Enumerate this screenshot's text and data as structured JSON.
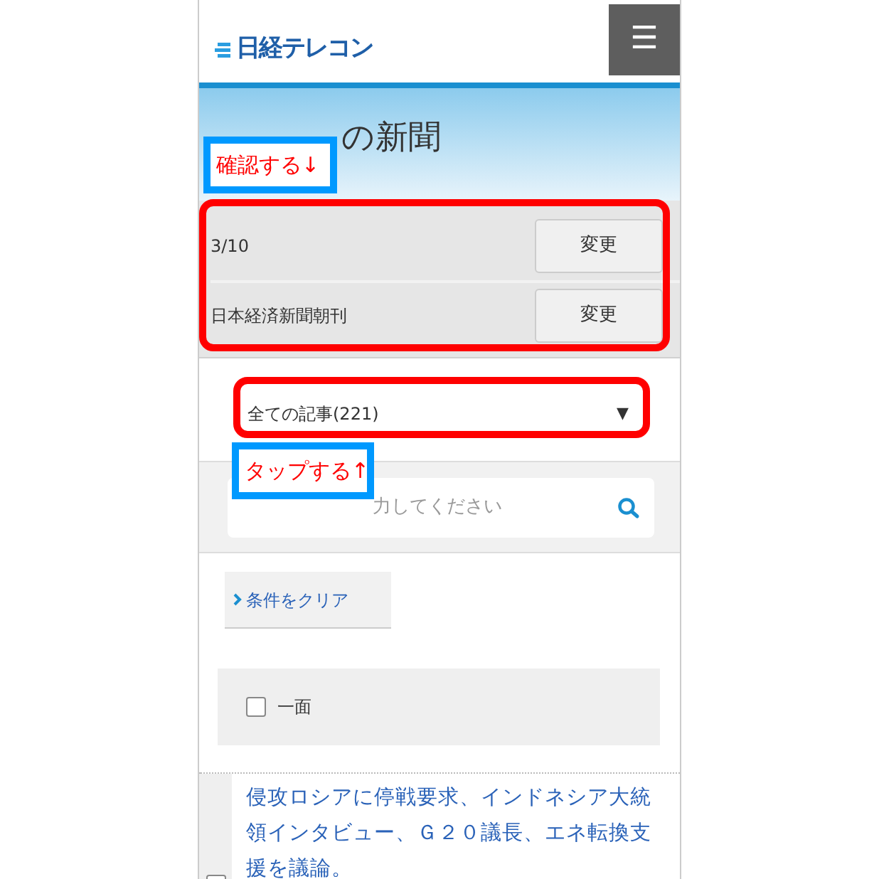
{
  "header": {
    "logo": "日経テレコン",
    "menu_icon": "☰"
  },
  "page_title": "の新聞",
  "settings": [
    {
      "value": "3/10",
      "button": "変更"
    },
    {
      "value": "日本経済新聞朝刊",
      "button": "変更"
    }
  ],
  "article_filter": {
    "value": "全ての記事(221)",
    "caret": "▼"
  },
  "search": {
    "placeholder": "力してください"
  },
  "clear_button": "条件をクリア",
  "page_group": {
    "label": "一面",
    "checked": false
  },
  "articles": [
    {
      "headline": "侵攻ロシアに停戦要求、インドネシア大統領インタビュー、Ｇ２０議長、エネ転換支援を議論。",
      "checked": false
    }
  ],
  "annotations": [
    {
      "text": "確認する↓"
    },
    {
      "text": "タップする↑"
    }
  ]
}
